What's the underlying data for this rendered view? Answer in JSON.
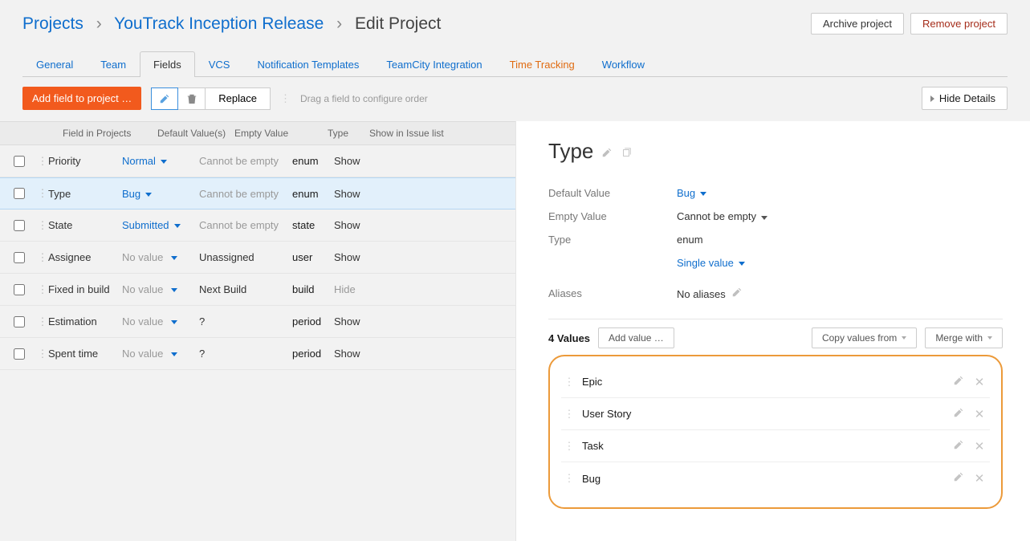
{
  "breadcrumb": {
    "root": "Projects",
    "project": "YouTrack Inception Release",
    "page": "Edit Project"
  },
  "topButtons": {
    "archive": "Archive project",
    "remove": "Remove project"
  },
  "tabs": [
    "General",
    "Team",
    "Fields",
    "VCS",
    "Notification Templates",
    "TeamCity Integration",
    "Time Tracking",
    "Workflow"
  ],
  "activeTab": "Fields",
  "toolbar": {
    "addField": "Add field to project …",
    "replace": "Replace",
    "hint": "Drag a field to configure order",
    "hideDetails": "Hide Details"
  },
  "columns": {
    "name": "Field in Projects",
    "default": "Default Value(s)",
    "empty": "Empty Value",
    "type": "Type",
    "show": "Show in Issue list"
  },
  "rows": [
    {
      "name": "Priority",
      "default": "Normal",
      "defaultLink": true,
      "empty": "Cannot be empty",
      "emptyMuted": true,
      "type": "enum",
      "show": "Show",
      "showMuted": false
    },
    {
      "name": "Type",
      "default": "Bug",
      "defaultLink": true,
      "empty": "Cannot be empty",
      "emptyMuted": true,
      "type": "enum",
      "show": "Show",
      "showMuted": false,
      "selected": true
    },
    {
      "name": "State",
      "default": "Submitted",
      "defaultLink": true,
      "empty": "Cannot be empty",
      "emptyMuted": true,
      "type": "state",
      "show": "Show",
      "showMuted": false
    },
    {
      "name": "Assignee",
      "default": "No value",
      "defaultLink": false,
      "empty": "Unassigned",
      "emptyMuted": false,
      "type": "user",
      "show": "Show",
      "showMuted": false
    },
    {
      "name": "Fixed in build",
      "default": "No value",
      "defaultLink": false,
      "empty": "Next Build",
      "emptyMuted": false,
      "type": "build",
      "show": "Hide",
      "showMuted": true
    },
    {
      "name": "Estimation",
      "default": "No value",
      "defaultLink": false,
      "empty": "?",
      "emptyMuted": false,
      "type": "period",
      "show": "Show",
      "showMuted": false
    },
    {
      "name": "Spent time",
      "default": "No value",
      "defaultLink": false,
      "empty": "?",
      "emptyMuted": false,
      "type": "period",
      "show": "Show",
      "showMuted": false
    }
  ],
  "panel": {
    "title": "Type",
    "defaultLabel": "Default Value",
    "defaultVal": "Bug",
    "emptyLabel": "Empty Value",
    "emptyVal": "Cannot be empty",
    "typeLabel": "Type",
    "typeVal": "enum",
    "cardinality": "Single value",
    "aliasLabel": "Aliases",
    "aliasVal": "No aliases",
    "valuesCount": "4 Values",
    "addValue": "Add value …",
    "copyFrom": "Copy values from",
    "mergeWith": "Merge with",
    "values": [
      "Epic",
      "User Story",
      "Task",
      "Bug"
    ]
  }
}
